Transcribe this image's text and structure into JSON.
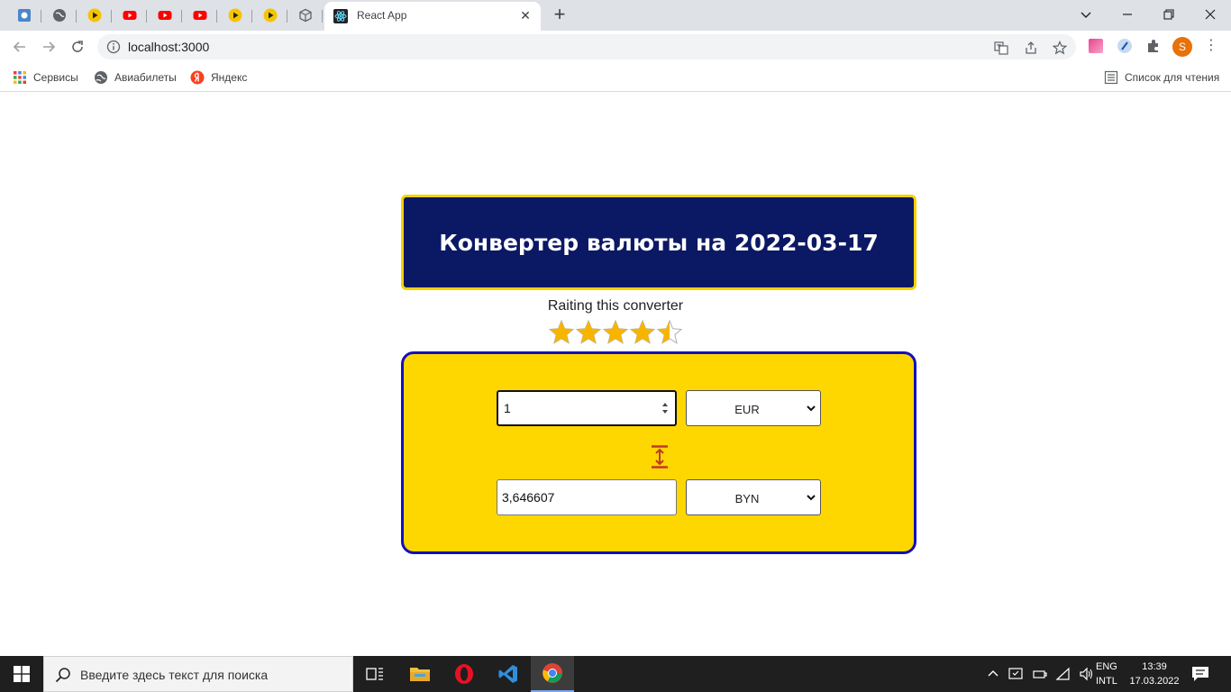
{
  "browser": {
    "pinned_tabs": [
      {
        "icon": "app-icon",
        "color": "#4a86c8"
      },
      {
        "icon": "globe-icon",
        "color": "#5f6368"
      },
      {
        "icon": "play-icon",
        "color": "#f5c400"
      },
      {
        "icon": "youtube-icon",
        "color": "#ff0000"
      },
      {
        "icon": "youtube-icon",
        "color": "#ff0000"
      },
      {
        "icon": "youtube-icon",
        "color": "#ff0000"
      },
      {
        "icon": "play-icon",
        "color": "#f5c400"
      },
      {
        "icon": "play-icon",
        "color": "#f5c400"
      },
      {
        "icon": "cube-icon",
        "color": "#5f6368"
      }
    ],
    "active_tab": {
      "title": "React App",
      "close": "✕"
    },
    "new_tab": "+",
    "window_controls": {
      "minimize": "—",
      "maximize": "❐",
      "close": "✕"
    },
    "address": {
      "url": "localhost:3000"
    },
    "bookmarks": [
      {
        "label": "Сервисы",
        "icon": "apps-grid-icon"
      },
      {
        "label": "Авиабилеты",
        "icon": "globe-icon"
      },
      {
        "label": "Яндекс",
        "icon": "yandex-icon"
      }
    ],
    "reading_list": "Список для чтения",
    "profile_initial": "S"
  },
  "page": {
    "title": "Конвертер валюты на 2022-03-17",
    "rating_label": "Raiting this converter",
    "rating": {
      "value": 4.5,
      "max": 5
    },
    "from": {
      "amount": "1",
      "currency": "EUR"
    },
    "to": {
      "amount": "3,646607",
      "currency": "BYN"
    },
    "colors": {
      "header_bg": "#0b1864",
      "accent_yellow": "#ffd700",
      "border_blue": "#1410b8",
      "star": "#f7b500",
      "swap_icon": "#c0392b"
    }
  },
  "taskbar": {
    "search_placeholder": "Введите здесь текст для поиска",
    "apps": [
      "task-view-icon",
      "file-explorer-icon",
      "opera-icon",
      "vscode-icon",
      "chrome-icon"
    ],
    "lang_line1": "ENG",
    "lang_line2": "INTL",
    "time": "13:39",
    "date": "17.03.2022"
  }
}
